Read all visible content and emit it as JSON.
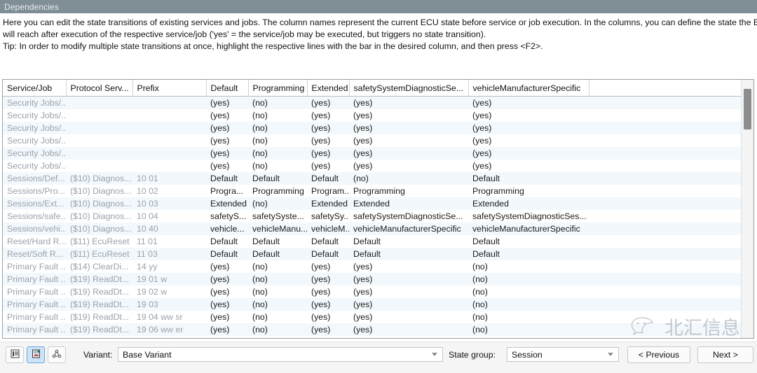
{
  "window": {
    "title": "Dependencies"
  },
  "description": {
    "line1": "Here you can edit the state transitions of existing services and jobs. The column names represent the current ECU state before service or job execution. In the columns, you can define the state the ECU",
    "line2": "will reach after execution of the respective service/job ('yes' = the service/job may be executed, but triggers no state transition).",
    "line3": "Tip: In order to modify multiple state transitions at once, highlight the respective lines with the bar in the desired column, and then press <F2>."
  },
  "table": {
    "columns": [
      "Service/Job",
      "Protocol Serv...",
      "Prefix",
      "Default",
      "Programming",
      "Extended",
      "safetySystemDiagnosticSe...",
      "vehicleManufacturerSpecific",
      ""
    ],
    "rows": [
      [
        "Security Jobs/...",
        "",
        "",
        "(yes)",
        "(no)",
        "(yes)",
        "(yes)",
        "(yes)",
        ""
      ],
      [
        "Security Jobs/...",
        "",
        "",
        "(yes)",
        "(no)",
        "(yes)",
        "(yes)",
        "(yes)",
        ""
      ],
      [
        "Security Jobs/...",
        "",
        "",
        "(yes)",
        "(no)",
        "(yes)",
        "(yes)",
        "(yes)",
        ""
      ],
      [
        "Security Jobs/...",
        "",
        "",
        "(yes)",
        "(no)",
        "(yes)",
        "(yes)",
        "(yes)",
        ""
      ],
      [
        "Security Jobs/...",
        "",
        "",
        "(yes)",
        "(no)",
        "(yes)",
        "(yes)",
        "(yes)",
        ""
      ],
      [
        "Security Jobs/...",
        "",
        "",
        "(yes)",
        "(no)",
        "(yes)",
        "(yes)",
        "(yes)",
        ""
      ],
      [
        "Sessions/Def...",
        "($10) Diagnos...",
        "10 01",
        "Default",
        "Default",
        "Default",
        "(no)",
        "Default",
        ""
      ],
      [
        "Sessions/Pro...",
        "($10) Diagnos...",
        "10 02",
        "Progra...",
        "Programming",
        "Program...",
        "Programming",
        "Programming",
        ""
      ],
      [
        "Sessions/Ext...",
        "($10) Diagnos...",
        "10 03",
        "Extended",
        "(no)",
        "Extended",
        "Extended",
        "Extended",
        ""
      ],
      [
        "Sessions/safe...",
        "($10) Diagnos...",
        "10 04",
        "safetyS...",
        "safetySyste...",
        "safetySy...",
        "safetySystemDiagnosticSe...",
        "safetySystemDiagnosticSes...",
        ""
      ],
      [
        "Sessions/vehi...",
        "($10) Diagnos...",
        "10 40",
        "vehicle...",
        "vehicleManu...",
        "vehicleM...",
        "vehicleManufacturerSpecific",
        "vehicleManufacturerSpecific",
        ""
      ],
      [
        "Reset/Hard R...",
        "($11) EcuReset",
        "11 01",
        "Default",
        "Default",
        "Default",
        "Default",
        "Default",
        ""
      ],
      [
        "Reset/Soft R...",
        "($11) EcuReset",
        "11 03",
        "Default",
        "Default",
        "Default",
        "Default",
        "Default",
        ""
      ],
      [
        "Primary Fault ...",
        "($14) ClearDi...",
        "14 yy",
        "(yes)",
        "(no)",
        "(yes)",
        "(yes)",
        "(no)",
        ""
      ],
      [
        "Primary Fault ...",
        "($19) ReadDt...",
        "19 01 w",
        "(yes)",
        "(no)",
        "(yes)",
        "(yes)",
        "(no)",
        ""
      ],
      [
        "Primary Fault ...",
        "($19) ReadDt...",
        "19 02 w",
        "(yes)",
        "(no)",
        "(yes)",
        "(yes)",
        "(no)",
        ""
      ],
      [
        "Primary Fault ...",
        "($19) ReadDt...",
        "19 03",
        "(yes)",
        "(no)",
        "(yes)",
        "(yes)",
        "(no)",
        ""
      ],
      [
        "Primary Fault ...",
        "($19) ReadDt...",
        "19 04 ww sr",
        "(yes)",
        "(no)",
        "(yes)",
        "(yes)",
        "(no)",
        ""
      ],
      [
        "Primary Fault ...",
        "($19) ReadDt...",
        "19 06 ww er",
        "(yes)",
        "(no)",
        "(yes)",
        "(yes)",
        "(no)",
        ""
      ]
    ]
  },
  "bottom": {
    "toolbar_icons": [
      "list-view-icon",
      "edit-table-icon",
      "dependency-graph-icon"
    ],
    "variant_label": "Variant:",
    "variant_value": "Base Variant",
    "state_group_label": "State group:",
    "state_group_value": "Session",
    "previous_label": "< Previous",
    "next_label": "Next >"
  },
  "watermark": {
    "text": "北汇信息",
    "icon": "wechat-icon"
  },
  "colors": {
    "titlebar": "#808e95",
    "alt_row": "#f2f8fc",
    "dim_text": "#9aa2ab",
    "accent": "#cfe3f7"
  }
}
